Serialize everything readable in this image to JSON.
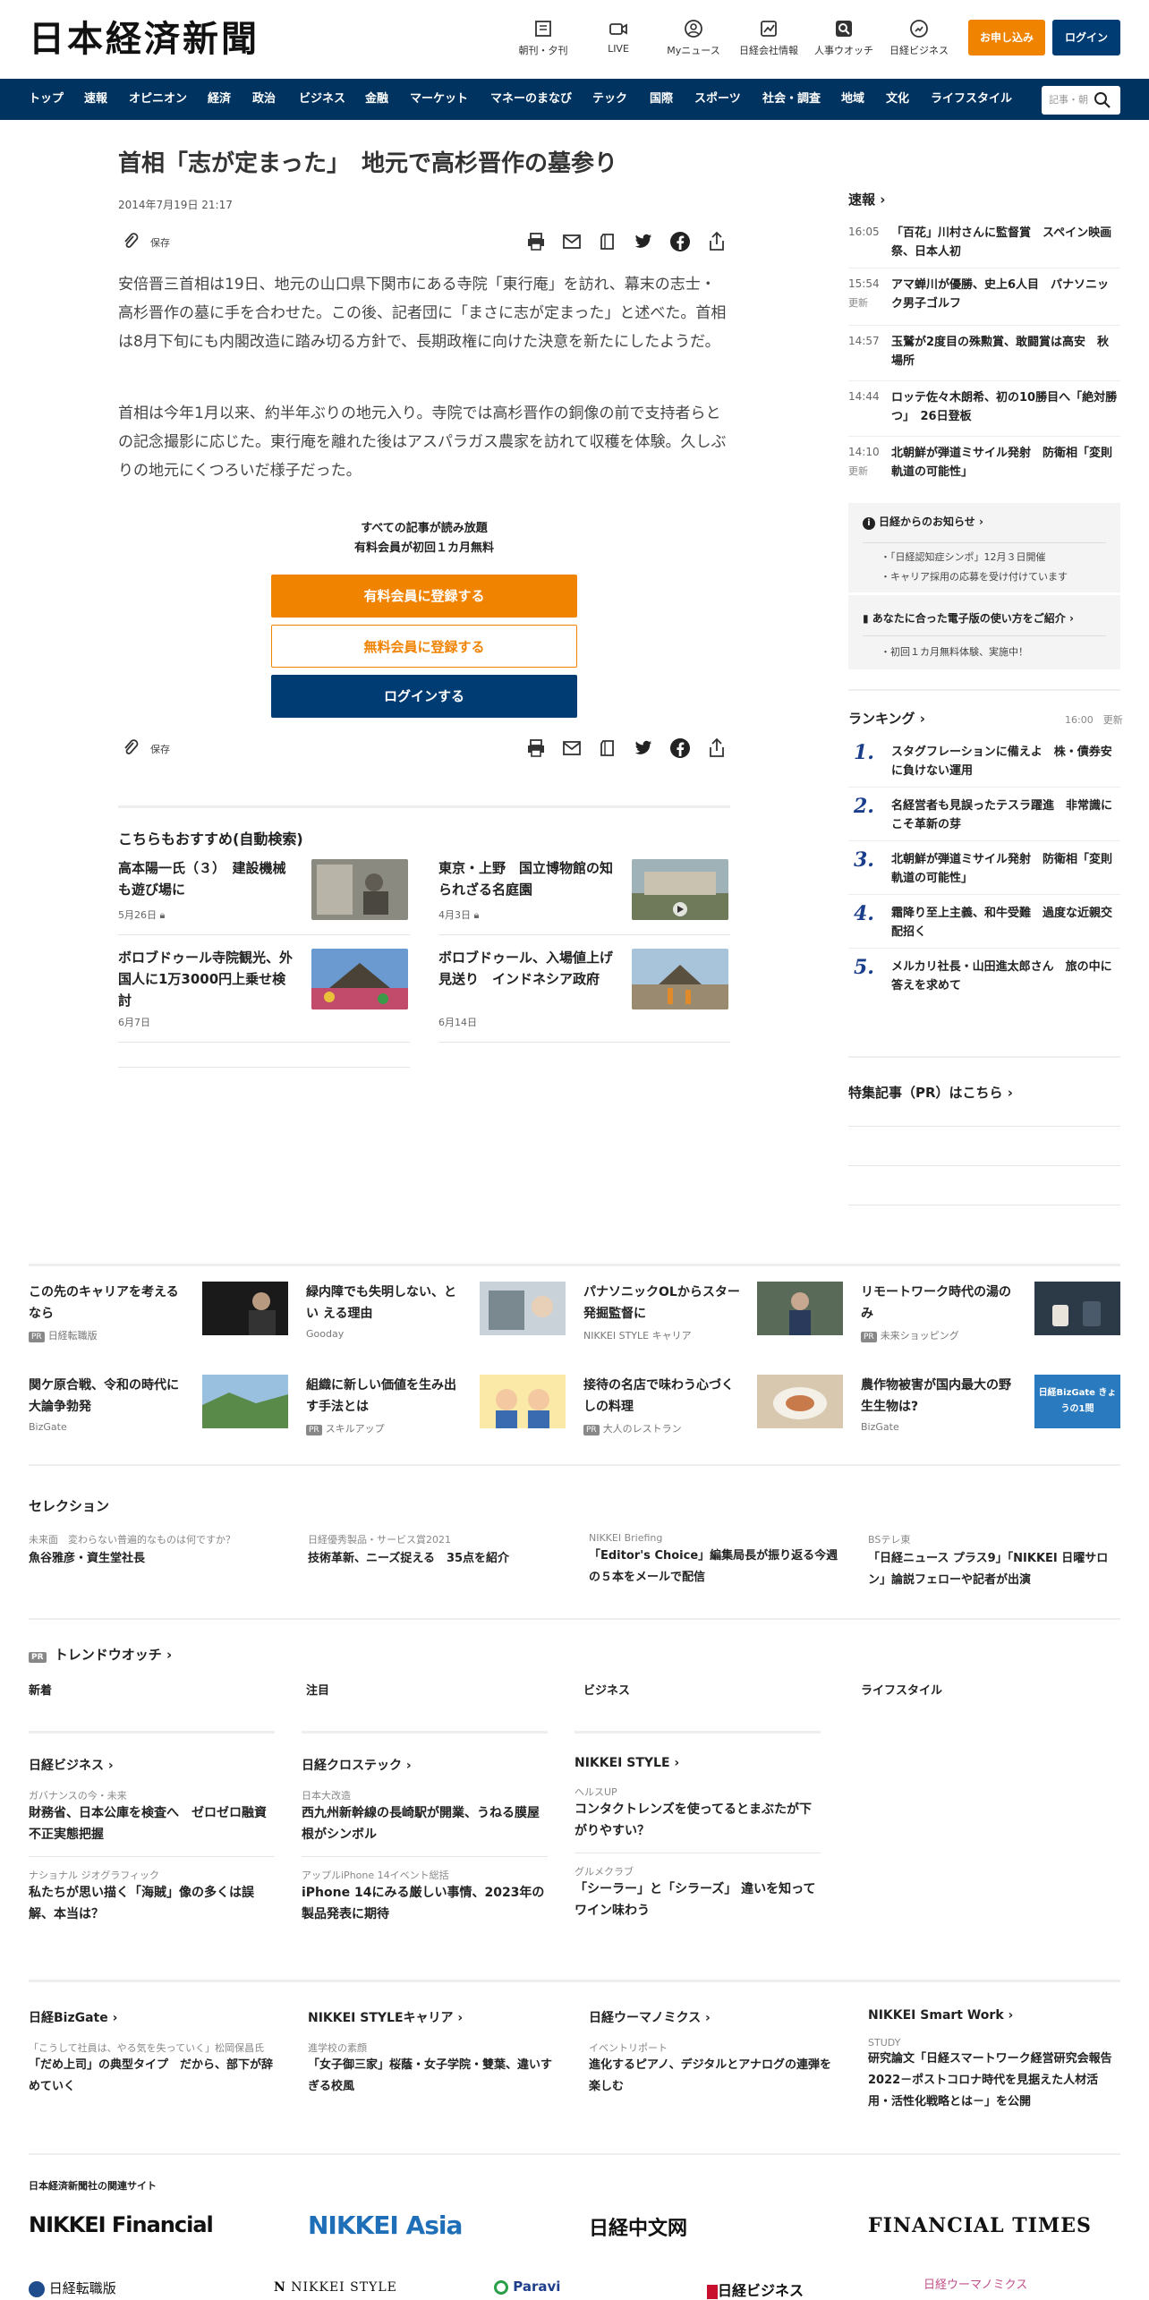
{
  "header": {
    "logo": "日本経済新聞",
    "icons": [
      {
        "label": "朝刊・夕刊",
        "icon": "newspaper-icon"
      },
      {
        "label": "LIVE",
        "icon": "video-icon"
      },
      {
        "label": "Myニュース",
        "icon": "user-icon"
      },
      {
        "label": "日経会社情報",
        "icon": "chart-icon"
      },
      {
        "label": "人事ウオッチ",
        "icon": "search-person-icon"
      },
      {
        "label": "日経ビジネス",
        "icon": "business-icon"
      }
    ],
    "apply": "お申し込み",
    "login": "ログイン"
  },
  "nav": [
    "トップ",
    "速報",
    "オピニオン",
    "経済",
    "政治",
    "ビジネス",
    "金融",
    "マーケット",
    "マネーのまなび",
    "テック",
    "国際",
    "スポーツ",
    "社会・調査",
    "地域",
    "文化",
    "ライフスタイル"
  ],
  "search": {
    "placeholder": "記事・朝"
  },
  "article": {
    "title": "首相「志が定まった」　地元で高杉晋作の墓参り",
    "date": "2014年7月19日 21:17",
    "save": "保存",
    "p1": "安倍晋三首相は19日、地元の山口県下関市にある寺院「東行庵」を訪れ、幕末の志士・高杉晋作の墓に手を合わせた。この後、記者団に「まさに志が定まった」と述べた。首相は8月下旬にも内閣改造に踏み切る方針で、長期政権に向けた決意を新たにしたようだ。",
    "p2": "首相は今年1月以来、約半年ぶりの地元入り。寺院では高杉晋作の銅像の前で支持者らとの記念撮影に応じた。東行庵を離れた後はアスパラガス農家を訪れて収穫を体験。久しぶりの地元にくつろいだ様子だった。"
  },
  "paywall": {
    "line1": "すべての記事が読み放題",
    "line2": "有料会員が初回１カ月無料",
    "paid": "有料会員に登録する",
    "free": "無料会員に登録する",
    "login": "ログインする"
  },
  "recommend": {
    "heading": "こちらもおすすめ(自動検索)",
    "items": [
      {
        "title": "高本陽一氏（３）　建設機械も遊び場に",
        "date": "5月26日"
      },
      {
        "title": "東京・上野　国立博物館の知られざる名庭園",
        "date": "4月3日"
      },
      {
        "title": "ボロブドゥール寺院観光、外国人に1万3000円上乗せ検討",
        "date": "6月7日"
      },
      {
        "title": "ボロブドゥール、入場値上げ見送り　インドネシア政府",
        "date": "6月14日"
      }
    ]
  },
  "sokuho": {
    "heading": "速報",
    "items": [
      {
        "time": "16:05",
        "text": "「百花」川村さんに監督賞　スペイン映画祭、日本人初"
      },
      {
        "time": "15:54",
        "updated": "更新",
        "text": "アマ蝉川が優勝、史上6人目　パナソニック男子ゴルフ"
      },
      {
        "time": "14:57",
        "text": "玉鷲が2度目の殊勲賞、敢闘賞は高安　秋場所"
      },
      {
        "time": "14:44",
        "text": "ロッテ佐々木朗希、初の10勝目へ「絶対勝つ」　26日登板"
      },
      {
        "time": "14:10",
        "updated": "更新",
        "text": "北朝鮮が弾道ミサイル発射　防衛相「変則軌道の可能性」"
      }
    ]
  },
  "notice": {
    "heading": "日経からのお知らせ",
    "items": [
      "「日経認知症シンポ」12月３日開催",
      "キャリア採用の応募を受け付けています"
    ],
    "heading2": "あなたに合った電子版の使い方をご紹介",
    "items2": [
      "初回１カ月無料体験、実施中！"
    ]
  },
  "ranking": {
    "heading": "ランキング",
    "time": "16:00",
    "updated": "更新",
    "items": [
      {
        "n": "1.",
        "text": "スタグフレーションに備えよ　株・債券安に負けない運用"
      },
      {
        "n": "2.",
        "text": "名経営者も見誤ったテスラ躍進　非常識にこそ革新の芽"
      },
      {
        "n": "3.",
        "text": "北朝鮮が弾道ミサイル発射　防衛相「変則軌道の可能性」"
      },
      {
        "n": "4.",
        "text": "霜降り至上主義、和牛受難　過度な近親交配招く"
      },
      {
        "n": "5.",
        "text": "メルカリ社長・山田進太郎さん　旅の中に答えを求めて"
      }
    ]
  },
  "tokushu": {
    "heading": "特集記事（PR）はこちら"
  },
  "promo": [
    {
      "title": "この先のキャリアを考えるなら",
      "source": "日経転職版",
      "pr": true
    },
    {
      "title": "緑内障でも失明しない、とい える理由",
      "source": "Gooday",
      "pr": false
    },
    {
      "title": "パナソニックOLからスター発掘監督に",
      "source": "NIKKEI STYLE キャリア",
      "pr": false
    },
    {
      "title": "リモートワーク時代の湯のみ",
      "source": "未来ショッピング",
      "pr": true
    },
    {
      "title": "関ケ原合戦、令和の時代に大論争勃発",
      "source": "BizGate",
      "pr": false
    },
    {
      "title": "組織に新しい価値を生み出す手法とは",
      "source": "スキルアップ",
      "pr": true
    },
    {
      "title": "接待の名店で味わう心づくしの料理",
      "source": "大人のレストラン",
      "pr": true
    },
    {
      "title": "農作物被害が国内最大の野生生物は?",
      "source": "BizGate",
      "pr": false,
      "thumb_text": "日経BizGate きょうの1問"
    }
  ],
  "selection": {
    "heading": "セレクション",
    "items": [
      {
        "cat": "未来面　変わらない普遍的なものは何ですか？",
        "title": "魚谷雅彦・資生堂社長"
      },
      {
        "cat": "日経優秀製品・サービス賞2021",
        "title": "技術革新、ニーズ捉える　35点を紹介"
      },
      {
        "cat": "NIKKEI Briefing",
        "title": "「Editor's Choice」編集局長が振り返る今週の５本をメールで配信"
      },
      {
        "cat": "BSテレ東",
        "title": "「日経ニュース プラス9」「NIKKEI 日曜サロン」論説フェローや記者が出演"
      }
    ]
  },
  "trend": {
    "pr": "PR",
    "heading": "トレンドウオッチ",
    "tabs": [
      "新着",
      "注目",
      "ビジネス",
      "ライフスタイル"
    ]
  },
  "media1": [
    {
      "name": "日経ビジネス",
      "items": [
        {
          "cat": "ガバナンスの今・未来",
          "title": "財務省、日本公庫を検査へ　ゼロゼロ融資不正実態把握"
        },
        {
          "cat": "ナショナル ジオグラフィック",
          "title": "私たちが思い描く「海賊」像の多くは誤解、本当は？"
        }
      ]
    },
    {
      "name": "日経クロステック",
      "items": [
        {
          "cat": "日本大改造",
          "title": "西九州新幹線の長崎駅が開業、うねる膜屋根がシンボル"
        },
        {
          "cat": "アップルiPhone 14イベント総括",
          "title": "iPhone 14にみる厳しい事情、2023年の製品発表に期待"
        }
      ]
    },
    {
      "name": "NIKKEI STYLE",
      "items": [
        {
          "cat": "ヘルスUP",
          "title": "コンタクトレンズを使ってるとまぶたが下がりやすい？"
        },
        {
          "cat": "グルメクラブ",
          "title": "「シーラー」と「シラーズ」 違いを知ってワイン味わう"
        }
      ]
    }
  ],
  "media2": [
    {
      "name": "日経BizGate",
      "cat": "「こうして社員は、やる気を失っていく」松岡保昌氏",
      "title": "「だめ上司」の典型タイプ　だから、部下が辞めていく"
    },
    {
      "name": "NIKKEI STYLEキャリア",
      "cat": "進学校の素顔",
      "title": "「女子御三家」桜蔭・女子学院・雙葉、違いすぎる校風"
    },
    {
      "name": "日経ウーマノミクス",
      "cat": "イベントリポート",
      "title": "進化するピアノ、デジタルとアナログの連弾を楽しむ"
    },
    {
      "name": "NIKKEI Smart Work",
      "cat": "STUDY",
      "title": "研究論文「日経スマートワーク経営研究会報告2022－ポストコロナ時代を見据えた人材活用・活性化戦略とは－」を公開"
    }
  ],
  "related": {
    "heading": "日本経済新聞社の関連サイト",
    "brands": [
      "NIKKEI Financial",
      "NIKKEI Asia",
      "日経中文网",
      "FINANCIAL TIMES",
      "日経転職版",
      "NIKKEI STYLE",
      "Paravi",
      "日経ビジネス",
      "日経ウーマノミクス"
    ]
  }
}
